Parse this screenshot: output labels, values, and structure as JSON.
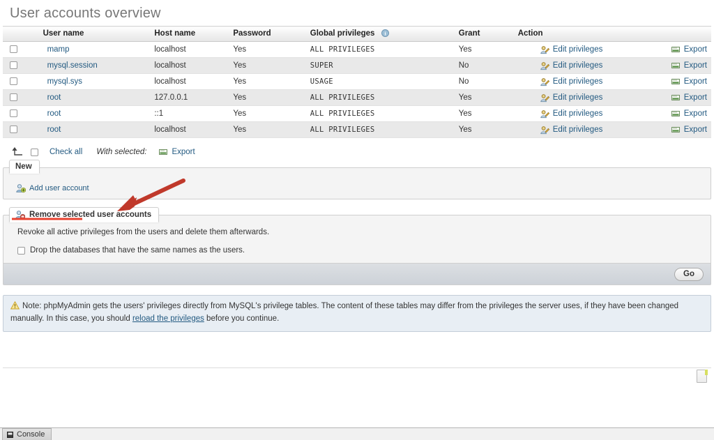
{
  "page": {
    "title": "User accounts overview"
  },
  "users_table": {
    "columns": [
      "",
      "User name",
      "Host name",
      "Password",
      "Global privileges",
      "Grant",
      "Action"
    ],
    "global_privileges_info_icon": "info-icon",
    "rows": [
      {
        "user": "mamp",
        "host": "localhost",
        "password": "Yes",
        "privileges": "ALL PRIVILEGES",
        "grant": "Yes",
        "edit": "Edit privileges",
        "export": "Export"
      },
      {
        "user": "mysql.session",
        "host": "localhost",
        "password": "Yes",
        "privileges": "SUPER",
        "grant": "No",
        "edit": "Edit privileges",
        "export": "Export"
      },
      {
        "user": "mysql.sys",
        "host": "localhost",
        "password": "Yes",
        "privileges": "USAGE",
        "grant": "No",
        "edit": "Edit privileges",
        "export": "Export"
      },
      {
        "user": "root",
        "host": "127.0.0.1",
        "password": "Yes",
        "privileges": "ALL PRIVILEGES",
        "grant": "Yes",
        "edit": "Edit privileges",
        "export": "Export"
      },
      {
        "user": "root",
        "host": "::1",
        "password": "Yes",
        "privileges": "ALL PRIVILEGES",
        "grant": "Yes",
        "edit": "Edit privileges",
        "export": "Export"
      },
      {
        "user": "root",
        "host": "localhost",
        "password": "Yes",
        "privileges": "ALL PRIVILEGES",
        "grant": "Yes",
        "edit": "Edit privileges",
        "export": "Export"
      }
    ]
  },
  "with_selected": {
    "select_all_icon": "select-all-arrow-icon",
    "check_all_label": "Check all",
    "with_selected_label": "With selected:",
    "export_label": "Export",
    "export_icon": "export-icon"
  },
  "new_section": {
    "legend": "New",
    "add_user_label": "Add user account",
    "add_user_icon": "add-user-icon"
  },
  "remove_section": {
    "legend": "Remove selected user accounts",
    "legend_icon": "remove-user-icon",
    "description": "Revoke all active privileges from the users and delete them afterwards.",
    "drop_db_label": "Drop the databases that have the same names as the users.",
    "drop_db_checked": false,
    "go_label": "Go"
  },
  "note": {
    "warn_icon": "warning-triangle-icon",
    "text_before": "Note: phpMyAdmin gets the users' privileges directly from MySQL's privilege tables. The content of these tables may differ from the privileges the server uses, if they have been changed manually. In this case, you should ",
    "link_text": "reload the privileges",
    "text_after": " before you continue."
  },
  "console": {
    "label": "Console",
    "icon": "console-icon"
  },
  "annotation": {
    "arrow_color": "#c0392b",
    "underline_color": "#e8412f"
  }
}
